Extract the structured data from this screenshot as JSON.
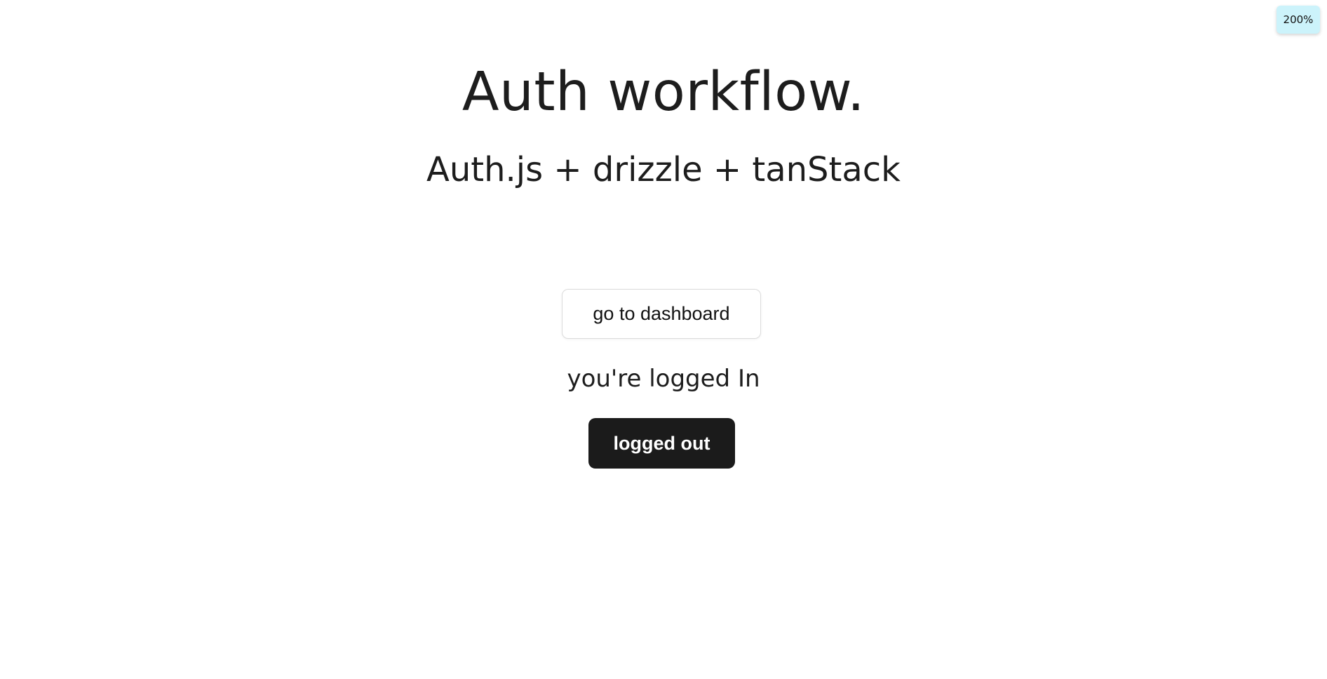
{
  "zoom": {
    "label": "200%",
    "background": "#ccf3fb"
  },
  "header": {
    "title": "Auth workflow.",
    "subtitle": "Auth.js + drizzle + tanStack"
  },
  "actions": {
    "dashboard_label": "go to dashboard",
    "status_text": "you're logged In",
    "logout_label": "logged out"
  },
  "colors": {
    "text": "#1d1d1d",
    "primary_button": "#1b1b1b",
    "secondary_border": "#dcdcdc"
  }
}
